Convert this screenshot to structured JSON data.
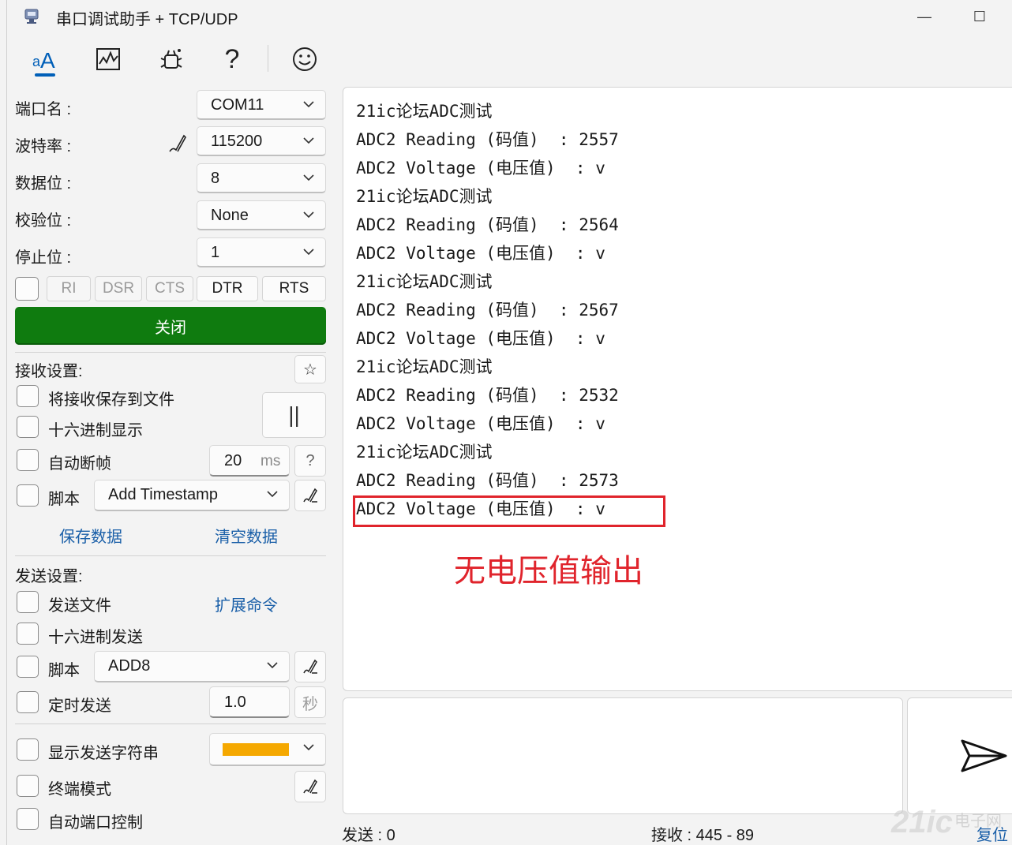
{
  "window": {
    "title": "串口调试助手 + TCP/UDP",
    "minimize": "—",
    "maximize": "☐"
  },
  "toolbar": {
    "items": [
      "text-format-icon",
      "waveform-icon",
      "debug-icon",
      "help-icon",
      "smiley-icon"
    ],
    "help_glyph": "?"
  },
  "serial": {
    "port_label": "端口名 :",
    "port_value": "COM11",
    "baud_label": "波特率 :",
    "baud_value": "115200",
    "databits_label": "数据位 :",
    "databits_value": "8",
    "parity_label": "校验位 :",
    "parity_value": "None",
    "stopbits_label": "停止位 :",
    "stopbits_value": "1",
    "signals": {
      "ri": "RI",
      "dsr": "DSR",
      "cts": "CTS",
      "dtr": "DTR",
      "rts": "RTS"
    },
    "close_button": "关闭"
  },
  "receive_settings": {
    "header": "接收设置:",
    "save_to_file": "将接收保存到文件",
    "hex_display": "十六进制显示",
    "auto_frame": "自动断帧",
    "frame_value": "20",
    "frame_unit": "ms",
    "frame_help": "?",
    "script_label": "脚本",
    "script_value": "Add Timestamp",
    "pause_glyph": "||",
    "star_glyph": "☆",
    "save_data": "保存数据",
    "clear_data": "清空数据"
  },
  "send_settings": {
    "header": "发送设置:",
    "send_file": "发送文件",
    "ext_commands": "扩展命令",
    "hex_send": "十六进制发送",
    "script_label": "脚本",
    "script_value": "ADD8",
    "timed_send": "定时发送",
    "timed_value": "1.0",
    "timed_unit": "秒",
    "show_send_string": "显示发送字符串",
    "terminal_mode": "终端模式",
    "auto_port_control": "自动端口控制",
    "color_swatch": "#f5a800"
  },
  "receive": {
    "lines": [
      "21ic论坛ADC测试",
      "ADC2 Reading (码值)  : 2557",
      "ADC2 Voltage (电压值)  : v",
      "21ic论坛ADC测试",
      "ADC2 Reading (码值)  : 2564",
      "ADC2 Voltage (电压值)  : v",
      "21ic论坛ADC测试",
      "ADC2 Reading (码值)  : 2567",
      "ADC2 Voltage (电压值)  : v",
      "21ic论坛ADC测试",
      "ADC2 Reading (码值)  : 2532",
      "ADC2 Voltage (电压值)  : v",
      "21ic论坛ADC测试",
      "ADC2 Reading (码值)  : 2573",
      "ADC2 Voltage (电压值)  : v"
    ],
    "annotation": "无电压值输出",
    "highlight_color": "#e0242c"
  },
  "status": {
    "sent": "发送 : 0",
    "received": "接收 : 445  -  89",
    "reset": "复位"
  },
  "watermark": {
    "logo": "21ic",
    "text": "电子网"
  },
  "colors": {
    "accent": "#005fb8",
    "close_button": "#0f7b0f",
    "link": "#1a5fa8"
  }
}
